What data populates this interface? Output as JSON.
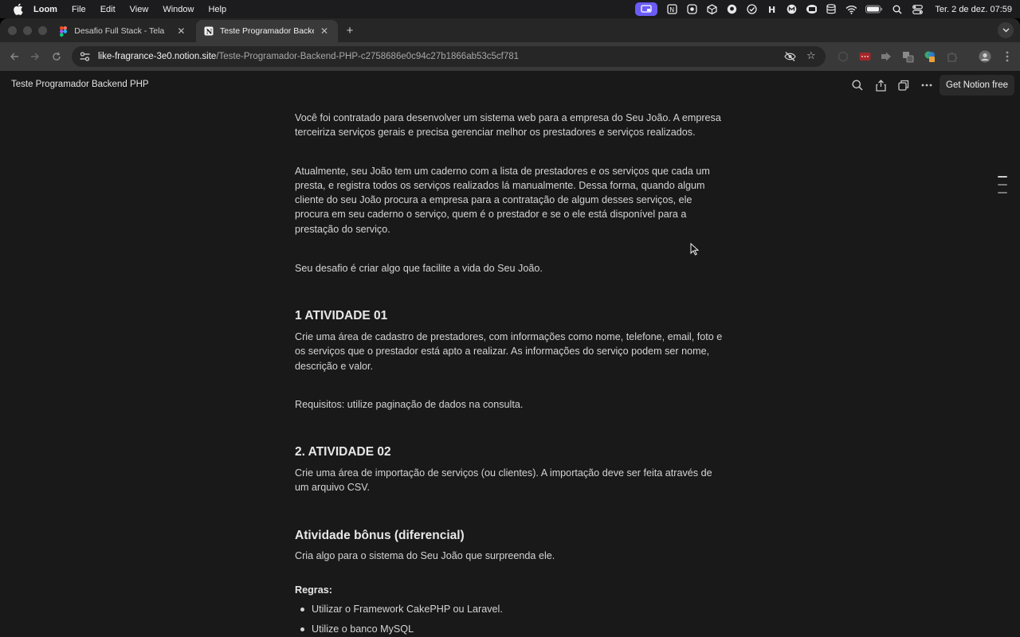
{
  "menubar": {
    "app_name": "Loom",
    "items": [
      "File",
      "Edit",
      "View",
      "Window",
      "Help"
    ],
    "clock": "Ter. 2 de dez.  07:59"
  },
  "browser": {
    "tabs": [
      {
        "title": "Desafio Full Stack - Tela",
        "icon": "figma-icon"
      },
      {
        "title": "Teste Programador Backend PHP",
        "icon": "notion-icon",
        "active": true
      }
    ],
    "url": {
      "host": "like-fragrance-3e0.notion.site",
      "path": "/Teste-Programador-Backend-PHP-c2758686e0c94c27b1866ab53c5cf781"
    }
  },
  "notion": {
    "page_title": "Teste Programador Backend PHP",
    "get_free_label": "Get Notion free"
  },
  "doc": {
    "p1_line1": "Você foi contratado para desenvolver um sistema web para a empresa do Seu João. A empresa",
    "p1_line2": "terceiriza serviços gerais e precisa gerenciar melhor os prestadores e serviços realizados.",
    "p2_line1": "Atualmente, seu João tem um caderno com a lista de prestadores e os serviços que cada um",
    "p2_line2": "presta, e registra todos os serviços realizados lá manualmente. Dessa forma, quando algum",
    "p2_line3": "cliente do seu João procura a empresa para a contratação de algum desses serviços, ele",
    "p2_line4": "procura em seu caderno o serviço, quem é o prestador e se o ele está disponível para a",
    "p2_line5": "prestação do serviço.",
    "p3": "Seu desafio é criar algo que facilite a vida do Seu João.",
    "h1": "1 ATIVIDADE 01",
    "p4_line1": "Crie uma área de cadastro de prestadores, com informações como nome, telefone, email, foto e",
    "p4_line2": "os serviços que o prestador está apto a realizar. As informações do serviço podem ser nome,",
    "p4_line3": "descrição e valor.",
    "p5": "Requisitos: utilize paginação de dados na consulta.",
    "h2": "2. ATIVIDADE 02",
    "p6_line1": "Crie uma área de importação de serviços (ou clientes). A importação deve ser feita através de",
    "p6_line2": "um arquivo CSV.",
    "h3": "Atividade bônus (diferencial)",
    "p7": "Cria algo para o sistema do Seu João que surpreenda ele.",
    "rules_label": "Regras:",
    "bullets": [
      "Utilizar o Framework CakePHP ou Laravel.",
      "Utilize o banco MySQL"
    ]
  }
}
